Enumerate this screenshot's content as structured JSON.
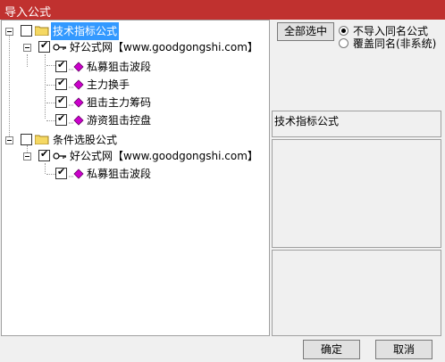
{
  "window": {
    "title": "导入公式"
  },
  "tree": {
    "groups": [
      {
        "label": "技术指标公式",
        "source": "好公式网【www.goodgongshi.com】",
        "items": [
          "私募狙击波段",
          "主力换手",
          "狙击主力筹码",
          "游资狙击控盘"
        ]
      },
      {
        "label": "条件选股公式",
        "source": "好公式网【www.goodgongshi.com】",
        "items": [
          "私募狙击波段"
        ]
      }
    ]
  },
  "options": {
    "select_all_label": "全部选中",
    "radio_skip_label": "不导入同名公式",
    "radio_overwrite_label": "覆盖同名(非系统)"
  },
  "info": {
    "category_label": "技术指标公式"
  },
  "footer": {
    "ok_label": "确定",
    "cancel_label": "取消"
  },
  "colors": {
    "titlebar": "#c0312f",
    "selection": "#3399ff",
    "formula_icon": "#cc00cc",
    "folder": "#f5d862"
  }
}
